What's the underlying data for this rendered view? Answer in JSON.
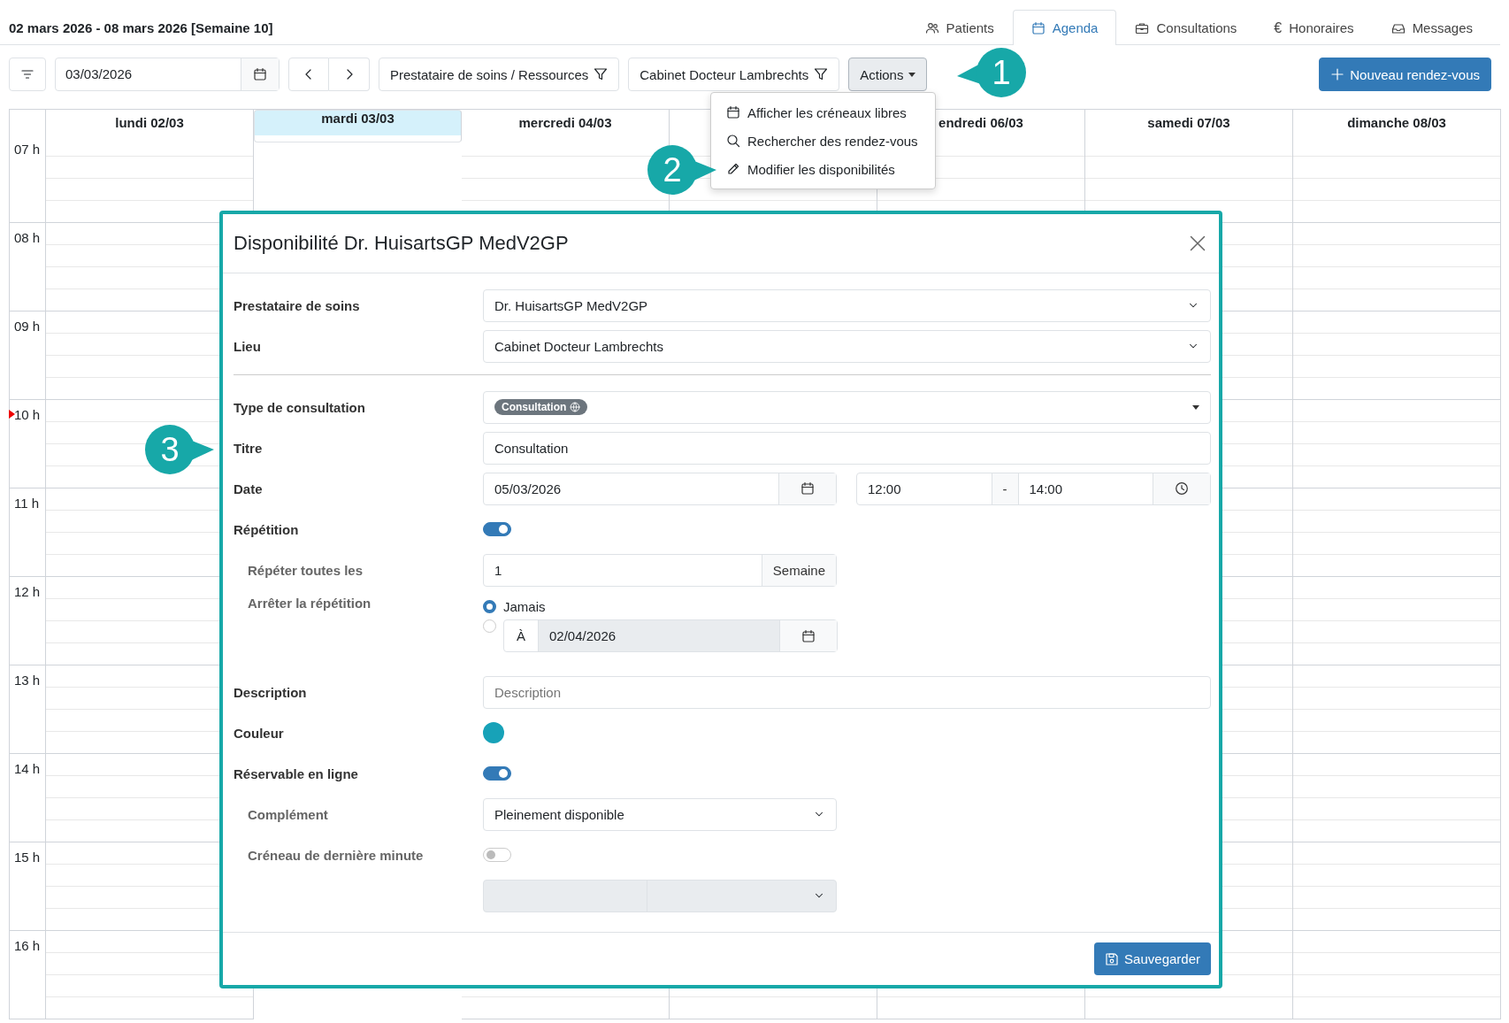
{
  "header": {
    "week_title": "02 mars 2026 - 08 mars 2026 [Semaine 10]"
  },
  "tabs": [
    {
      "kind": "patients",
      "label": "Patients",
      "selected": false
    },
    {
      "kind": "agenda",
      "label": "Agenda",
      "selected": true
    },
    {
      "kind": "consultations",
      "label": "Consultations",
      "selected": false
    },
    {
      "kind": "fees",
      "glyph": "€",
      "label": "Honoraires",
      "selected": false
    },
    {
      "kind": "messages",
      "label": "Messages",
      "selected": false
    }
  ],
  "toolbar": {
    "date": "03/03/2026",
    "provider_filter": "Prestataire de soins / Ressources",
    "location_filter": "Cabinet Docteur Lambrechts",
    "actions": "Actions",
    "new_button": "Nouveau rendez-vous"
  },
  "actions_menu": [
    {
      "kind": "calendar",
      "label": "Afficher les créneaux libres"
    },
    {
      "kind": "search",
      "label": "Rechercher des rendez-vous"
    },
    {
      "kind": "pencil",
      "label": "Modifier les disponibilités"
    }
  ],
  "calendar": {
    "days": [
      {
        "label": "lundi 02/03",
        "selected": false
      },
      {
        "label": "mardi 03/03",
        "selected": true
      },
      {
        "label": "mercredi 04/03",
        "selected": false
      },
      {
        "selected": false
      },
      {
        "label": "endredi 06/03",
        "selected": false
      },
      {
        "label": "samedi 07/03",
        "selected": false
      },
      {
        "label": "dimanche 08/03",
        "selected": false
      }
    ],
    "hours": [
      {
        "label": "07 h",
        "now": false
      },
      {
        "label": "08 h",
        "now": false
      },
      {
        "label": "09 h",
        "now": false
      },
      {
        "label": "10 h",
        "now": true
      },
      {
        "label": "11 h",
        "now": false
      },
      {
        "label": "12 h",
        "now": false
      },
      {
        "label": "13 h",
        "now": false
      },
      {
        "label": "14 h",
        "now": false
      },
      {
        "label": "15 h",
        "now": false
      },
      {
        "label": "16 h",
        "now": false
      }
    ]
  },
  "callouts": [
    "1",
    "2",
    "3"
  ],
  "modal": {
    "title": "Disponibilité Dr. HuisartsGP MedV2GP",
    "provider": {
      "label": "Prestataire de soins",
      "value": "Dr. HuisartsGP MedV2GP"
    },
    "location": {
      "label": "Lieu",
      "value": "Cabinet Docteur Lambrechts"
    },
    "consultation_type": {
      "label": "Type de consultation",
      "tag": "Consultation"
    },
    "title_field": {
      "label": "Titre",
      "value": "Consultation"
    },
    "date": {
      "label": "Date",
      "date": "05/03/2026",
      "start": "12:00",
      "separator": "-",
      "end": "14:00"
    },
    "repetition": {
      "label": "Répétition",
      "on": true
    },
    "repeat_every": {
      "label": "Répéter toutes les",
      "value": "1",
      "unit": "Semaine"
    },
    "stop_repetition": {
      "label": "Arrêter la répétition",
      "options": [
        {
          "kind": "never",
          "label": "Jamais",
          "selected": true
        },
        {
          "kind": "date",
          "prefix": "À",
          "date": "02/04/2026",
          "selected": false
        }
      ]
    },
    "description": {
      "label": "Description",
      "placeholder": "Description"
    },
    "color": {
      "label": "Couleur",
      "color": "#17a2b8"
    },
    "online_booking": {
      "label": "Réservable en ligne",
      "on": true
    },
    "complement": {
      "label": "Complément",
      "value": "Pleinement disponible"
    },
    "last_minute": {
      "label": "Créneau de dernière minute",
      "on": false
    },
    "save": "Sauvegarder"
  }
}
